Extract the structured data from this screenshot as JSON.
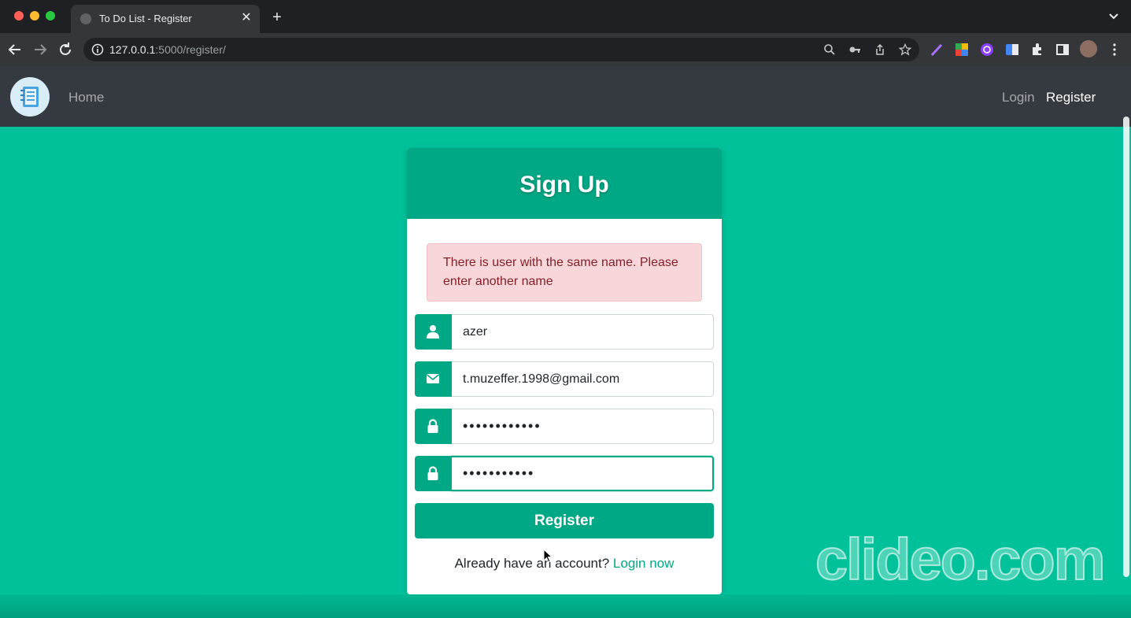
{
  "browser": {
    "tab_title": "To Do List - Register",
    "url_host": "127.0.0.1",
    "url_rest": ":5000/register/",
    "new_tab_label": "+",
    "close_label": "✕"
  },
  "navbar": {
    "home": "Home",
    "login": "Login",
    "register": "Register"
  },
  "signup": {
    "title": "Sign Up",
    "alert": "There is user with the same name. Please enter another name",
    "username_value": "azer",
    "email_value": "t.muzeffer.1998@gmail.com",
    "password_value": "••••••••••••",
    "confirm_value": "•••••••••••",
    "register_button": "Register",
    "login_prompt": "Already have an account?",
    "login_link": "Login now"
  },
  "watermark": "clideo.com",
  "colors": {
    "page_bg": "#00c19a",
    "accent": "#00a885",
    "navbar": "#343a40",
    "alert_bg": "#f8d7da",
    "alert_text": "#842029"
  }
}
